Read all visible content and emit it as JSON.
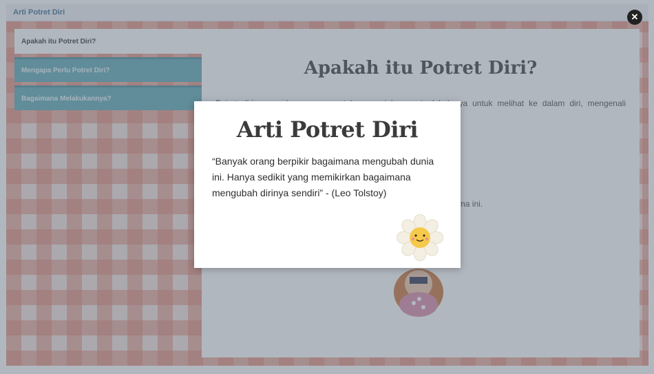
{
  "window": {
    "title": "Arti Potret Diri"
  },
  "sidebar": {
    "items": [
      {
        "label": "Apakah itu Potret Diri?"
      },
      {
        "label": "Mengapa Perlu Potret Diri?"
      },
      {
        "label": "Bagaimana Melakukannya?"
      }
    ]
  },
  "main": {
    "heading": "Apakah itu Potret Diri?",
    "paragraph1": "Potret diri merupakan sarana untuk mengajak peserta lokakarya untuk melihat ke dalam diri, mengenali perubahan, kemajuan, dan merefleksikan pengalaman dalam",
    "paragraph2": "                                                                          stan partisipatif selama ini."
  },
  "modal": {
    "title": "Arti Potret Diri",
    "quote": "“Banyak orang berpikir bagaimana mengubah dunia ini. Hanya sedikit yang memikirkan bagaimana mengubah dirinya sendiri” - (Leo Tolstoy)",
    "close_label": "✕"
  },
  "colors": {
    "accent_teal": "#5fa8b5",
    "plaid": "#de7d69",
    "title_blue": "#3a6e8f"
  },
  "icons": [
    "close-icon",
    "flower-icon"
  ]
}
